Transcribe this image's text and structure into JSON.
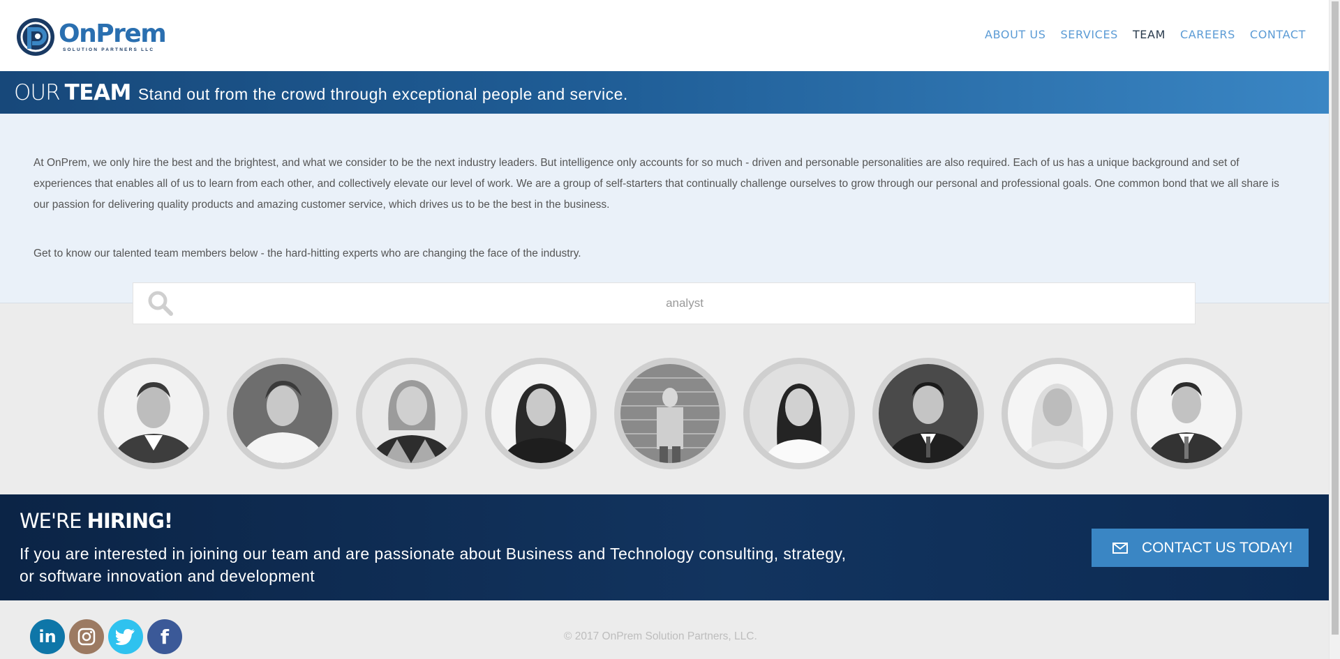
{
  "header": {
    "logo_name": "OnPrem",
    "logo_sub": "SOLUTION PARTNERS LLC",
    "nav": [
      "ABOUT US",
      "SERVICES",
      "TEAM",
      "CAREERS",
      "CONTACT"
    ],
    "active_nav": "TEAM"
  },
  "banner": {
    "our": "OUR",
    "team": "TEAM",
    "tagline": "Stand out from the crowd through exceptional people and service."
  },
  "intro": {
    "paragraph1": "At OnPrem, we only hire the best and the brightest, and what we consider to be the next industry leaders. But intelligence only accounts for so much - driven and personable personalities are also required. Each of us has a unique background and set of experiences that enables all of us to learn from each other, and collectively elevate our level of work. We are a group of self-starters that continually challenge ourselves to grow through our personal and professional goals. One common bond that we all share is our passion for delivering quality products and amazing customer service, which drives us to be the best in the business.",
    "paragraph2": "Get to know our talented team members below - the hard-hitting experts who are changing the face of the industry."
  },
  "search": {
    "value": "analyst",
    "icon": "search-icon"
  },
  "hiring": {
    "title_light": "WE'RE",
    "title_bold": "HIRING!",
    "text": "If you are interested in joining our team and are passionate about Business and Technology consulting, strategy, or software innovation and development",
    "cta_label": "CONTACT US TODAY!",
    "cta_icon": "envelope-icon"
  },
  "footer": {
    "socials": [
      {
        "name": "linkedin",
        "label": "in",
        "color": "#0e76a8"
      },
      {
        "name": "instagram",
        "label": "",
        "color": "#9c7a62"
      },
      {
        "name": "twitter",
        "label": "",
        "color": "#2fc2ef"
      },
      {
        "name": "facebook",
        "label": "f",
        "color": "#3b5998"
      }
    ],
    "copyright": "© 2017 OnPrem Solution Partners, LLC."
  },
  "colors": {
    "brand_blue": "#2a6fb0",
    "nav_blue": "#5b9bd5",
    "banner_dark": "#17487a",
    "hiring_navy": "#0b2446",
    "cta_blue": "#3a86c4"
  }
}
